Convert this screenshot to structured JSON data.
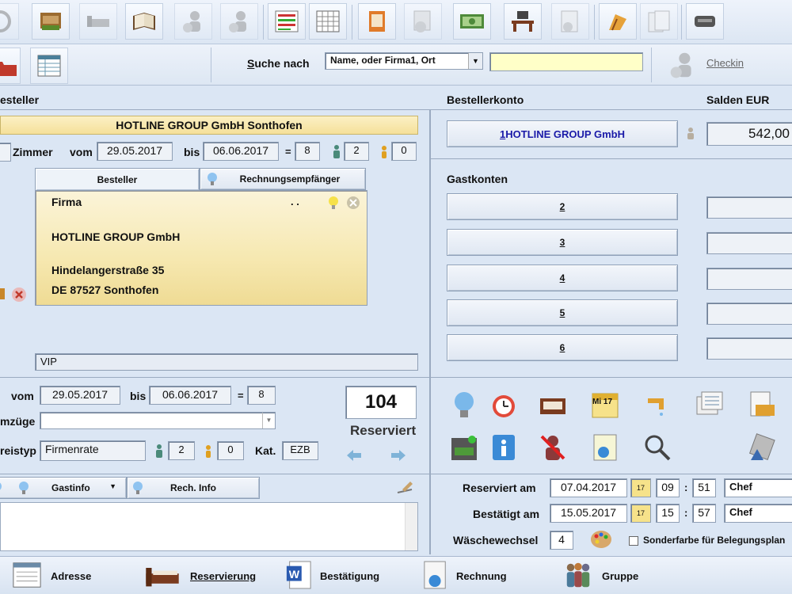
{
  "toolbar": {
    "items": [
      "power-icon",
      "cash-drawer-icon",
      "bed-icon",
      "book-icon",
      "guest-in-icon",
      "guest-out-icon",
      "list-icon",
      "calendar-grid-icon",
      "folder-icon",
      "euro-guests-icon",
      "money-icon",
      "desk-icon",
      "currency-doc-icon",
      "beach-chair-icon",
      "document-stack-icon",
      "card-reader-icon"
    ]
  },
  "search": {
    "label_prefix": "S",
    "label": "uche nach",
    "select_value": "Name, oder Firma1, Ort",
    "input_value": "",
    "checkin_label": "Checkin"
  },
  "left": {
    "section_title": "esteller",
    "company_header": "HOTLINE GROUP GmbH Sonthofen",
    "zimmer_label": "Zimmer",
    "vom_label": "vom",
    "vom_value": "29.05.2017",
    "bis_label": "bis",
    "bis_value": "06.06.2017",
    "eq": "=",
    "nights": "8",
    "adults": "2",
    "children": "0",
    "tab_besteller": "Besteller",
    "tab_rechnung": "Rechnungsempfänger",
    "addr_firma": "Firma",
    "addr_dots": ". .",
    "addr_company": "HOTLINE GROUP GmbH",
    "addr_street": "Hindelangerstraße 35",
    "addr_city": "DE 87527 Sonthofen",
    "vip": "VIP"
  },
  "stay": {
    "vom_label": "vom",
    "vom_value": "29.05.2017",
    "bis_label": "bis",
    "bis_value": "06.06.2017",
    "eq": "=",
    "nights": "8",
    "umzuege_label": "mzüge",
    "preistyp_label": "reistyp",
    "preistyp_value": "Firmenrate",
    "adults": "2",
    "children": "0",
    "kat_label": "Kat.",
    "kat_value": "EZB",
    "room_number": "104",
    "status": "Reserviert"
  },
  "info_tabs": {
    "gastinfo": "Gastinfo",
    "rech_info": "Rech. Info"
  },
  "right": {
    "konto_title": "Bestellerkonto",
    "salden_title": "Salden EUR",
    "account_1_num": "1",
    "account_1_name": " HOTLINE GROUP GmbH",
    "balance_1": "542,00",
    "gastkonten_title": "Gastkonten",
    "accounts": [
      "2",
      "3",
      "4",
      "5",
      "6"
    ],
    "calendar_text": "Mi 17"
  },
  "dates": {
    "reserviert_label": "Reserviert am",
    "reserviert_date": "07.04.2017",
    "reserviert_hh": "09",
    "reserviert_mm": "51",
    "reserviert_user": "Chef",
    "bestaetigt_label": "Bestätigt am",
    "bestaetigt_date": "15.05.2017",
    "bestaetigt_hh": "15",
    "bestaetigt_mm": "57",
    "bestaetigt_user": "Chef",
    "colon": ":",
    "cal_small": "17",
    "waesche_label": "Wäschewechsel",
    "waesche_value": "4",
    "sonderfarbe_label": "Sonderfarbe für Belegungsplan"
  },
  "bottom": {
    "adresse": "Adresse",
    "reservierung": "Reservierung",
    "bestaetigung": "Bestätigung",
    "rechnung": "Rechnung",
    "gruppe": "Gruppe"
  },
  "colors": {
    "background": "#dbe6f4",
    "link_blue": "#1a1aa8",
    "address_yellow": "#f6e8b0",
    "search_yellow": "#ffffc8"
  }
}
